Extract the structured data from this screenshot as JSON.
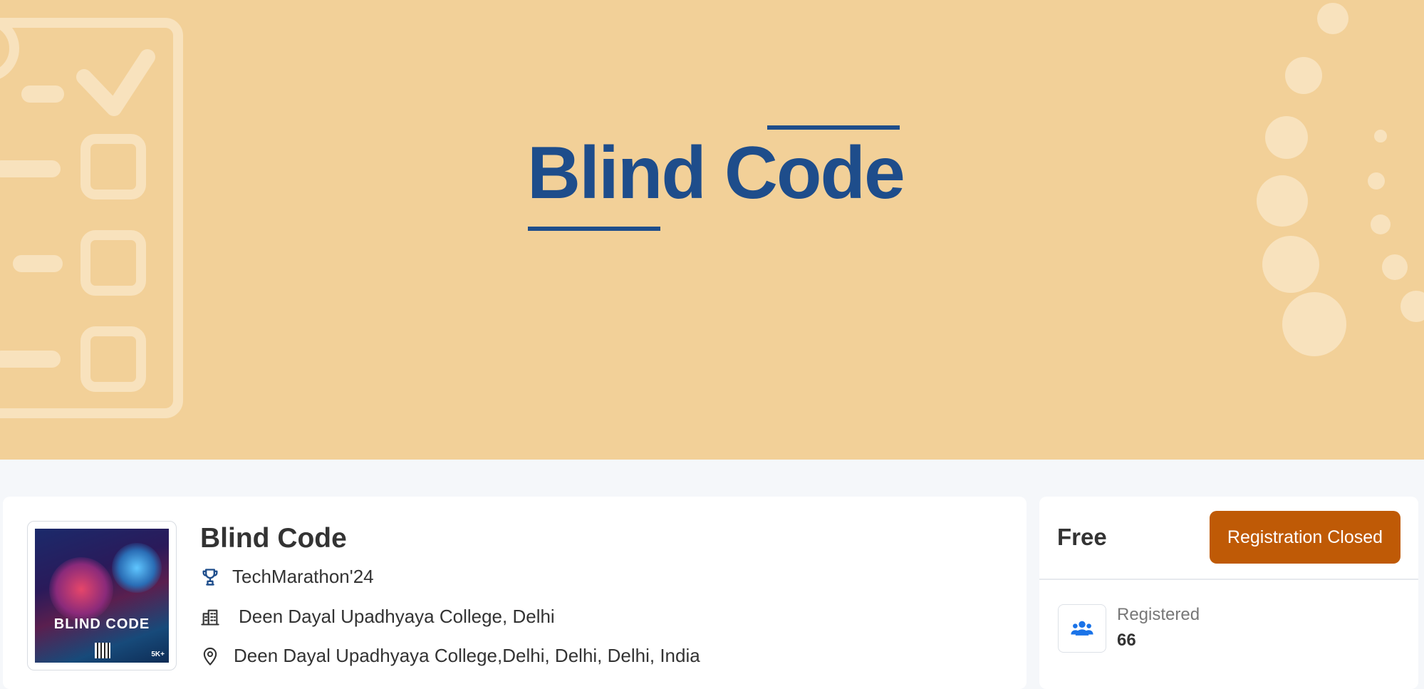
{
  "banner": {
    "title": "Blind Code",
    "colors": {
      "background": "#f2d098",
      "title": "#1e4d8b",
      "decoration": "#f8e2bd"
    }
  },
  "event": {
    "title": "Blind Code",
    "festival": "TechMarathon'24",
    "college": "Deen Dayal Upadhyaya College, Delhi",
    "location": "Deen Dayal Upadhyaya College,Delhi, Delhi, Delhi, India",
    "icons": {
      "festival": "trophy-icon",
      "college": "building-icon",
      "location": "map-pin-icon"
    },
    "poster": {
      "title": "BLIND CODE",
      "badge": "5K+"
    }
  },
  "registration": {
    "price": "Free",
    "button_label": "Registration Closed",
    "button_color": "#bf5a06",
    "registered_label": "Registered",
    "registered_count": "66",
    "icon": "users-icon"
  }
}
